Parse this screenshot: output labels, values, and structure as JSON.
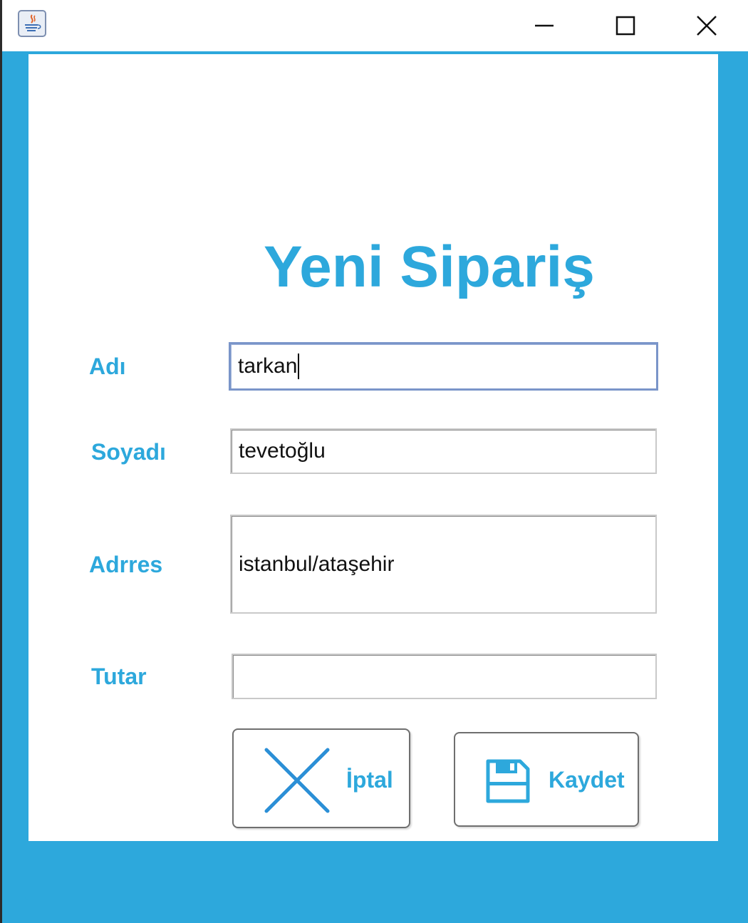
{
  "window": {
    "app_icon": "java-icon",
    "controls": {
      "minimize": "minimize-icon",
      "maximize": "maximize-icon",
      "close": "close-icon"
    }
  },
  "form": {
    "title": "Yeni Sipariş",
    "fields": {
      "adi": {
        "label": "Adı",
        "value": "tarkan"
      },
      "soyadi": {
        "label": "Soyadı",
        "value": "tevetoğlu"
      },
      "adres": {
        "label": "Adrres",
        "value": "istanbul/ataşehir"
      },
      "tutar": {
        "label": "Tutar",
        "value": ""
      }
    },
    "buttons": {
      "cancel": {
        "label": "İptal",
        "icon": "x-icon"
      },
      "save": {
        "label": "Kaydet",
        "icon": "floppy-disk-icon"
      }
    }
  },
  "colors": {
    "accent": "#2da8dc",
    "focus_border": "#7a95c9"
  }
}
